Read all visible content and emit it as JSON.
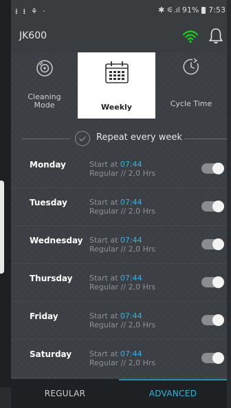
{
  "status_bar": {
    "left_icons": "⭳ ⭳ ⚘ ·",
    "bluetooth": "✱",
    "signal": "⚟.ıl",
    "battery": "91%",
    "time": "7:53"
  },
  "app_bar": {
    "title": "JK600",
    "wifi_icon": "wifi-icon",
    "bell_icon": "bell-icon",
    "wifi_color": "#19c81e"
  },
  "tabs": [
    {
      "id": "cleaning-mode",
      "label_line1": "Cleaning",
      "label_line2": "Mode",
      "icon": "cleaning-mode-icon"
    },
    {
      "id": "weekly",
      "label": "Weekly",
      "icon": "calendar-icon",
      "active": true
    },
    {
      "id": "cycle-time",
      "label": "Cycle Time",
      "icon": "clock-icon"
    }
  ],
  "repeat": {
    "label": "Repeat every week",
    "icon": "check-circle-icon"
  },
  "days": [
    {
      "name": "Monday",
      "start_prefix": "Start at",
      "time": "07:44",
      "detail": "Regular  // 2,0 Hrs",
      "enabled": false
    },
    {
      "name": "Tuesday",
      "start_prefix": "Start at",
      "time": "07:44",
      "detail": "Regular  // 2,0 Hrs",
      "enabled": false
    },
    {
      "name": "Wednesday",
      "start_prefix": "Start at",
      "time": "07:44",
      "detail": "Regular  // 2,0 Hrs",
      "enabled": false
    },
    {
      "name": "Thursday",
      "start_prefix": "Start at",
      "time": "07:44",
      "detail": "Regular  // 2,0 Hrs",
      "enabled": false
    },
    {
      "name": "Friday",
      "start_prefix": "Start at",
      "time": "07:44",
      "detail": "Regular  // 2,0 Hrs",
      "enabled": false
    },
    {
      "name": "Saturday",
      "start_prefix": "Start at",
      "time": "07:44",
      "detail": "Regular  // 2,0 Hrs",
      "enabled": false
    }
  ],
  "bottom_tabs": [
    {
      "label": "REGULAR",
      "active": false
    },
    {
      "label": "ADVANCED",
      "active": true
    }
  ],
  "colors": {
    "accent": "#35b5e5",
    "background": "#3c3f43",
    "active_tab_bg": "#ffffff"
  }
}
